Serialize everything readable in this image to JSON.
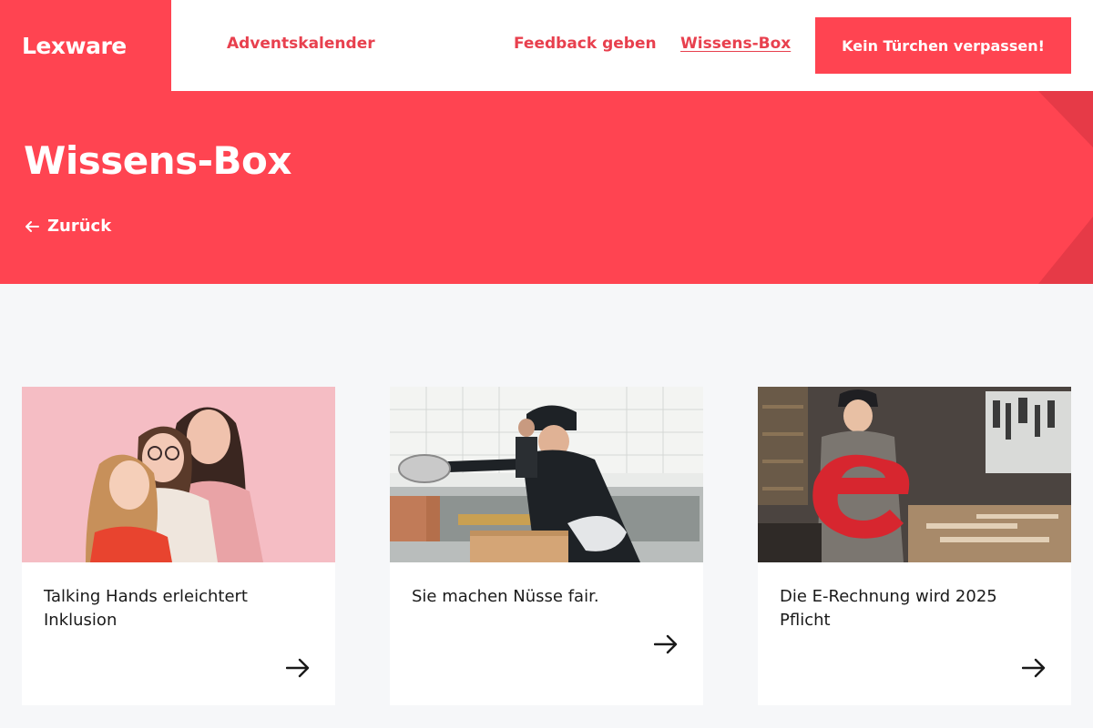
{
  "header": {
    "logo": "Lexware",
    "nav": {
      "advent": "Adventskalender",
      "feedback": "Feedback geben",
      "wissen": "Wissens-Box"
    },
    "cta": "Kein Türchen verpassen!"
  },
  "hero": {
    "title": "Wissens-Box",
    "back": "Zurück"
  },
  "cards": [
    {
      "title": "Talking Hands erleichtert Inklusion"
    },
    {
      "title": "Sie machen Nüsse fair."
    },
    {
      "title": "Die E-Rechnung wird 2025 Pflicht"
    }
  ],
  "colors": {
    "brand": "#ff4451",
    "brand_text": "#e8404e",
    "page_bg": "#f6f7f9"
  }
}
